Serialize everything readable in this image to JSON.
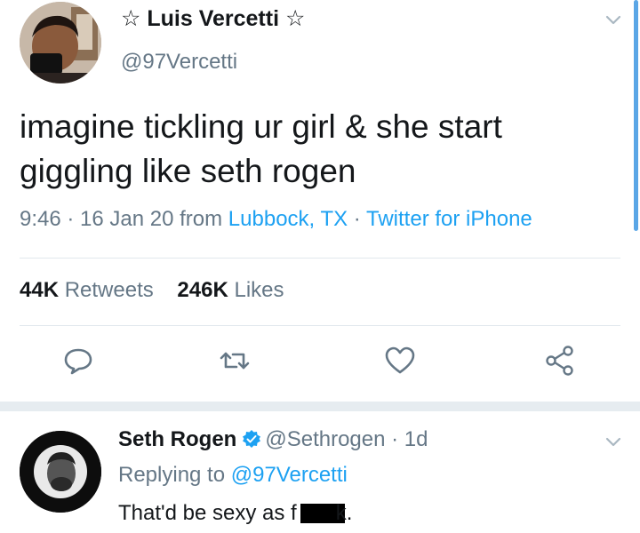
{
  "tweet": {
    "display_name": "☆ Luis Vercetti ☆",
    "handle": "@97Vercetti",
    "text_line1": "imagine tickling ur girl & she start",
    "text_line2": "giggling like seth rogen",
    "meta_time": "9:46 · 16 Jan 20 from ",
    "meta_location": "Lubbock, TX",
    "meta_sep": " · ",
    "meta_client": "Twitter for iPhone",
    "retweets_count": "44K",
    "retweets_label": "Retweets",
    "likes_count": "246K",
    "likes_label": "Likes",
    "icons": [
      "reply-icon",
      "retweet-icon",
      "like-icon",
      "share-icon",
      "chevron-down-icon"
    ]
  },
  "reply": {
    "display_name": "Seth Rogen",
    "handle_time": "@Sethrogen · 1d",
    "replying_prefix": "Replying to ",
    "replying_handle": "@97Vercetti",
    "text_before": "That'd be sexy as f",
    "text_after": "k.",
    "icons": [
      "verified-badge-icon",
      "chevron-down-icon"
    ]
  },
  "colors": {
    "link": "#1da1f2",
    "secondary_text": "#657786",
    "primary_text": "#14171a",
    "separator": "#e6ecf0"
  }
}
